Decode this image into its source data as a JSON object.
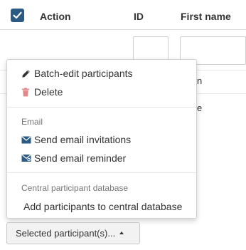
{
  "table": {
    "headers": {
      "action": "Action",
      "id": "ID",
      "first_name": "First name"
    },
    "peek_cells": [
      "n",
      "e"
    ]
  },
  "menu": {
    "items": [
      {
        "label": "Batch-edit participants",
        "icon": "pencil-icon"
      },
      {
        "label": "Delete",
        "icon": "trash-icon"
      }
    ],
    "email_section": {
      "title": "Email",
      "items": [
        {
          "label": "Send email invitations",
          "icon": "envelope-icon"
        },
        {
          "label": "Send email reminder",
          "icon": "envelope-reminder-icon"
        }
      ]
    },
    "cpdb_section": {
      "title": "Central participant database",
      "items": [
        {
          "label": "Add participants to central database"
        }
      ]
    }
  },
  "button": {
    "label": "Selected participant(s)..."
  },
  "colors": {
    "checkbox": "#2b5b84",
    "delete_icon": "#d9534f",
    "email_icon": "#2b5b84"
  }
}
